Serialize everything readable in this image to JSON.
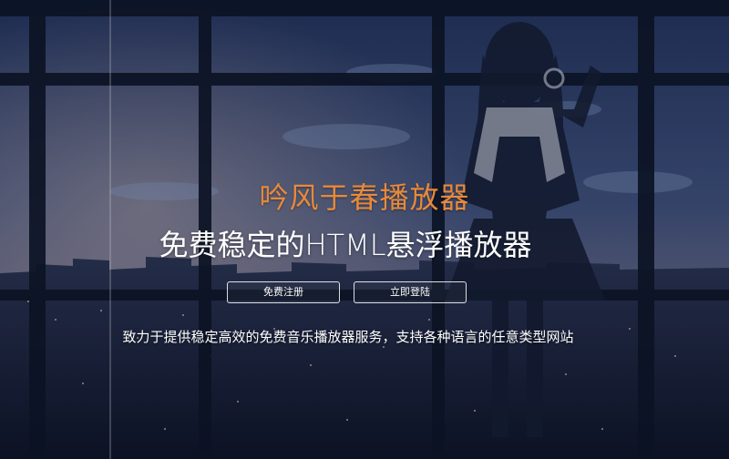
{
  "hero": {
    "brand": "吟风于春播放器",
    "headline": "免费稳定的HTML悬浮播放器",
    "register_label": "免费注册",
    "login_label": "立即登陆",
    "tagline": "致力于提供稳定高效的免费音乐播放器服务，支持各种语言的任意类型网站"
  },
  "colors": {
    "brand": "#e8893a",
    "sky_top": "#28395c",
    "sky_bottom": "#6e6a80",
    "window_frame": "#0e1626",
    "city": "#1a2236"
  }
}
